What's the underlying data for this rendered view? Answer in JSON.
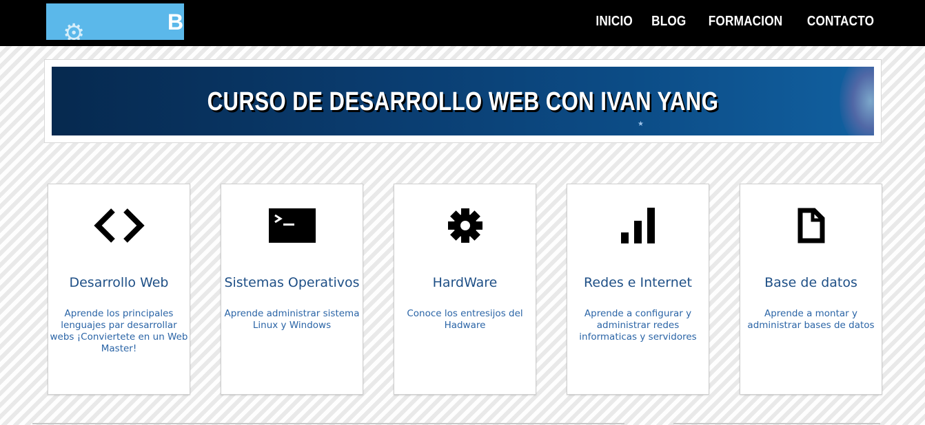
{
  "header": {
    "logo_text": "Bl",
    "logo_icon": "gear-icon",
    "nav": [
      {
        "label": "INICIO"
      },
      {
        "label": "BLOG"
      },
      {
        "label": "FORMACION"
      },
      {
        "label": "CONTACTO"
      }
    ]
  },
  "banner": {
    "title": "CURSO DE DESARROLLO WEB CON IVAN YANG"
  },
  "cards": [
    {
      "icon": "code-icon",
      "title": "Desarrollo Web",
      "text": "Aprende los principales lenguajes par desarrollar webs ¡Conviertete en un Web Master!"
    },
    {
      "icon": "terminal-icon",
      "title": "Sistemas Operativos",
      "text": "Aprende administrar sistema Linux y Windows"
    },
    {
      "icon": "gear-icon",
      "title": "HardWare",
      "text": "Conoce los entresijos del Hadware"
    },
    {
      "icon": "signal-bars-icon",
      "title": "Redes e Internet",
      "text": "Aprende a configurar y administrar redes informaticas y servidores"
    },
    {
      "icon": "document-icon",
      "title": "Base de datos",
      "text": "Aprende a montar y administrar bases de datos"
    }
  ],
  "colors": {
    "header_bg": "#000000",
    "logo_bg": "#5bb8ea",
    "banner_bg": "#0a3c6f",
    "card_title": "#1e4f86",
    "card_text": "#2a64a6"
  }
}
